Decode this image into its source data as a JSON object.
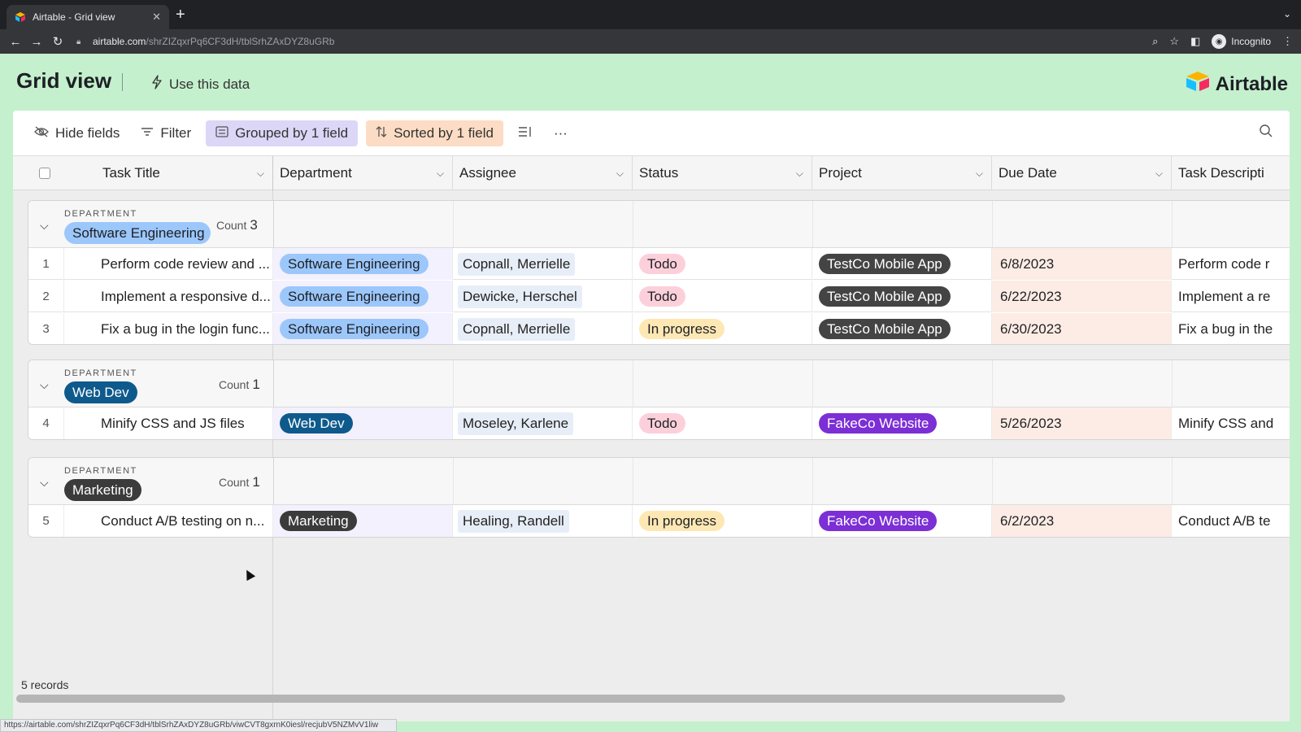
{
  "browser": {
    "tab_title": "Airtable - Grid view",
    "tab_close": "✕",
    "new_tab": "+",
    "url_host": "airtable.com",
    "url_path": "/shrZIZqxrPq6CF3dH/tblSrhZAxDYZ8uGRb",
    "incognito_label": "Incognito",
    "status_url": "https://airtable.com/shrZIZqxrPq6CF3dH/tblSrhZAxDYZ8uGRb/viwCVT8gxrnK0iesl/recjubV5NZMvV1liw"
  },
  "header": {
    "title": "Grid view",
    "use_data": "Use this data",
    "logo": "Airtable"
  },
  "toolbar": {
    "hide_fields": "Hide fields",
    "filter": "Filter",
    "grouped": "Grouped by 1 field",
    "sorted": "Sorted by 1 field",
    "more": "···"
  },
  "columns": [
    "Task Title",
    "Department",
    "Assignee",
    "Status",
    "Project",
    "Due Date",
    "Task Descripti"
  ],
  "group_label": "DEPARTMENT",
  "count_label": "Count",
  "groups": [
    {
      "name": "Software Engineering",
      "count": "3",
      "rows": [
        {
          "num": "1",
          "title": "Perform code review and ...",
          "dept": "Software Engineering",
          "assignee": "Copnall, Merrielle",
          "status": "Todo",
          "project": "TestCo Mobile App",
          "due": "6/8/2023",
          "desc": "Perform code r"
        },
        {
          "num": "2",
          "title": "Implement a responsive d...",
          "dept": "Software Engineering",
          "assignee": "Dewicke, Herschel",
          "status": "Todo",
          "project": "TestCo Mobile App",
          "due": "6/22/2023",
          "desc": "Implement a re"
        },
        {
          "num": "3",
          "title": "Fix a bug in the login func...",
          "dept": "Software Engineering",
          "assignee": "Copnall, Merrielle",
          "status": "In progress",
          "project": "TestCo Mobile App",
          "due": "6/30/2023",
          "desc": "Fix a bug in the"
        }
      ]
    },
    {
      "name": "Web Dev",
      "count": "1",
      "rows": [
        {
          "num": "4",
          "title": "Minify CSS and JS files",
          "dept": "Web Dev",
          "assignee": "Moseley, Karlene",
          "status": "Todo",
          "project": "FakeCo Website",
          "due": "5/26/2023",
          "desc": "Minify CSS and"
        }
      ]
    },
    {
      "name": "Marketing",
      "count": "1",
      "rows": [
        {
          "num": "5",
          "title": "Conduct A/B testing on n...",
          "dept": "Marketing",
          "assignee": "Healing, Randell",
          "status": "In progress",
          "project": "FakeCo Website",
          "due": "6/2/2023",
          "desc": "Conduct A/B te"
        }
      ]
    }
  ],
  "footer": {
    "records": "5 records"
  },
  "colors": {
    "Software Engineering": {
      "bg": "#9cc7fa",
      "fg": "#1d1f25"
    },
    "Web Dev": {
      "bg": "#0f5a8c",
      "fg": "#ffffff"
    },
    "Marketing": {
      "bg": "#3b3b3b",
      "fg": "#ffffff"
    },
    "Todo": {
      "bg": "#fcd0da",
      "fg": "#1d1f25"
    },
    "In progress": {
      "bg": "#fde8b4",
      "fg": "#1d1f25"
    },
    "TestCo Mobile App": {
      "bg": "#444444",
      "fg": "#ffffff"
    },
    "FakeCo Website": {
      "bg": "#7b2fd4",
      "fg": "#ffffff"
    }
  }
}
